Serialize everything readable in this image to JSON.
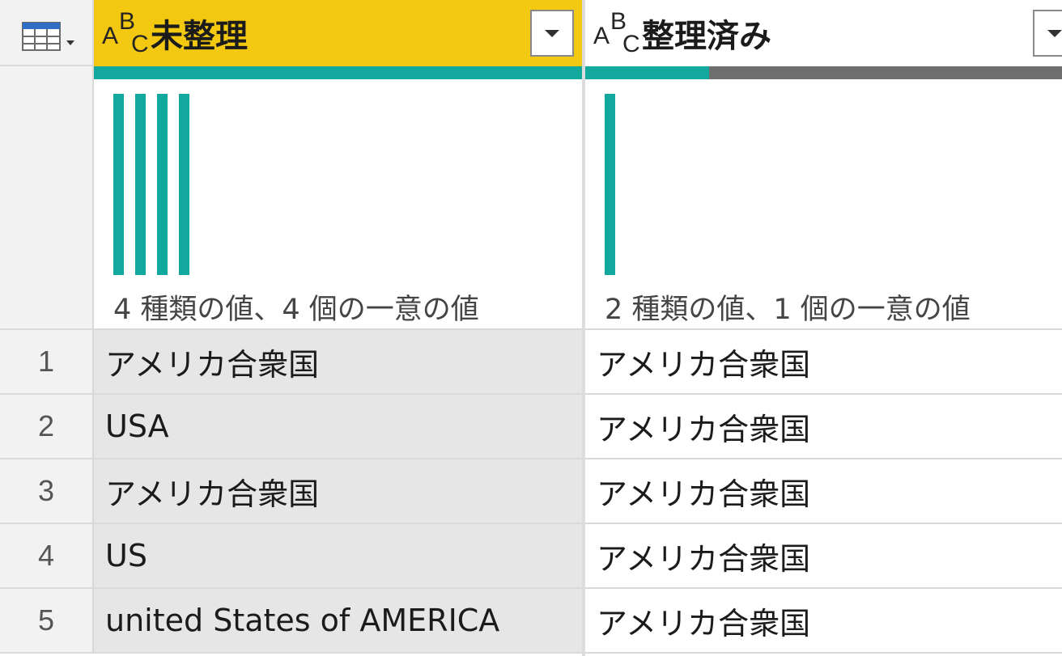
{
  "columns": [
    {
      "type_icon": {
        "a": "A",
        "b": "B",
        "c": "C"
      },
      "title": "未整理",
      "profile_text": "4 種類の値、4 個の一意の値",
      "distribution_bars": 4,
      "valid_fraction": 1.0,
      "selected": true
    },
    {
      "type_icon": {
        "a": "A",
        "b": "B",
        "c": "C"
      },
      "title": "整理済み",
      "profile_text": "2 種類の値、1 個の一意の値",
      "distribution_bars": 1,
      "valid_fraction": 0.26,
      "selected": false
    }
  ],
  "rows": [
    {
      "num": "1",
      "cells": [
        "アメリカ合衆国",
        "アメリカ合衆国"
      ]
    },
    {
      "num": "2",
      "cells": [
        "USA",
        "アメリカ合衆国"
      ]
    },
    {
      "num": "3",
      "cells": [
        "アメリカ合衆国",
        "アメリカ合衆国"
      ]
    },
    {
      "num": "4",
      "cells": [
        "US",
        "アメリカ合衆国"
      ]
    },
    {
      "num": "5",
      "cells": [
        "united States of AMERICA",
        "アメリカ合衆国"
      ]
    }
  ],
  "colors": {
    "selected_header": "#f2c811",
    "valid": "#12a89d",
    "empty": "#6e6e6e",
    "selected_cell": "#e6e6e6"
  },
  "icons": {
    "table_menu": "table-icon"
  }
}
